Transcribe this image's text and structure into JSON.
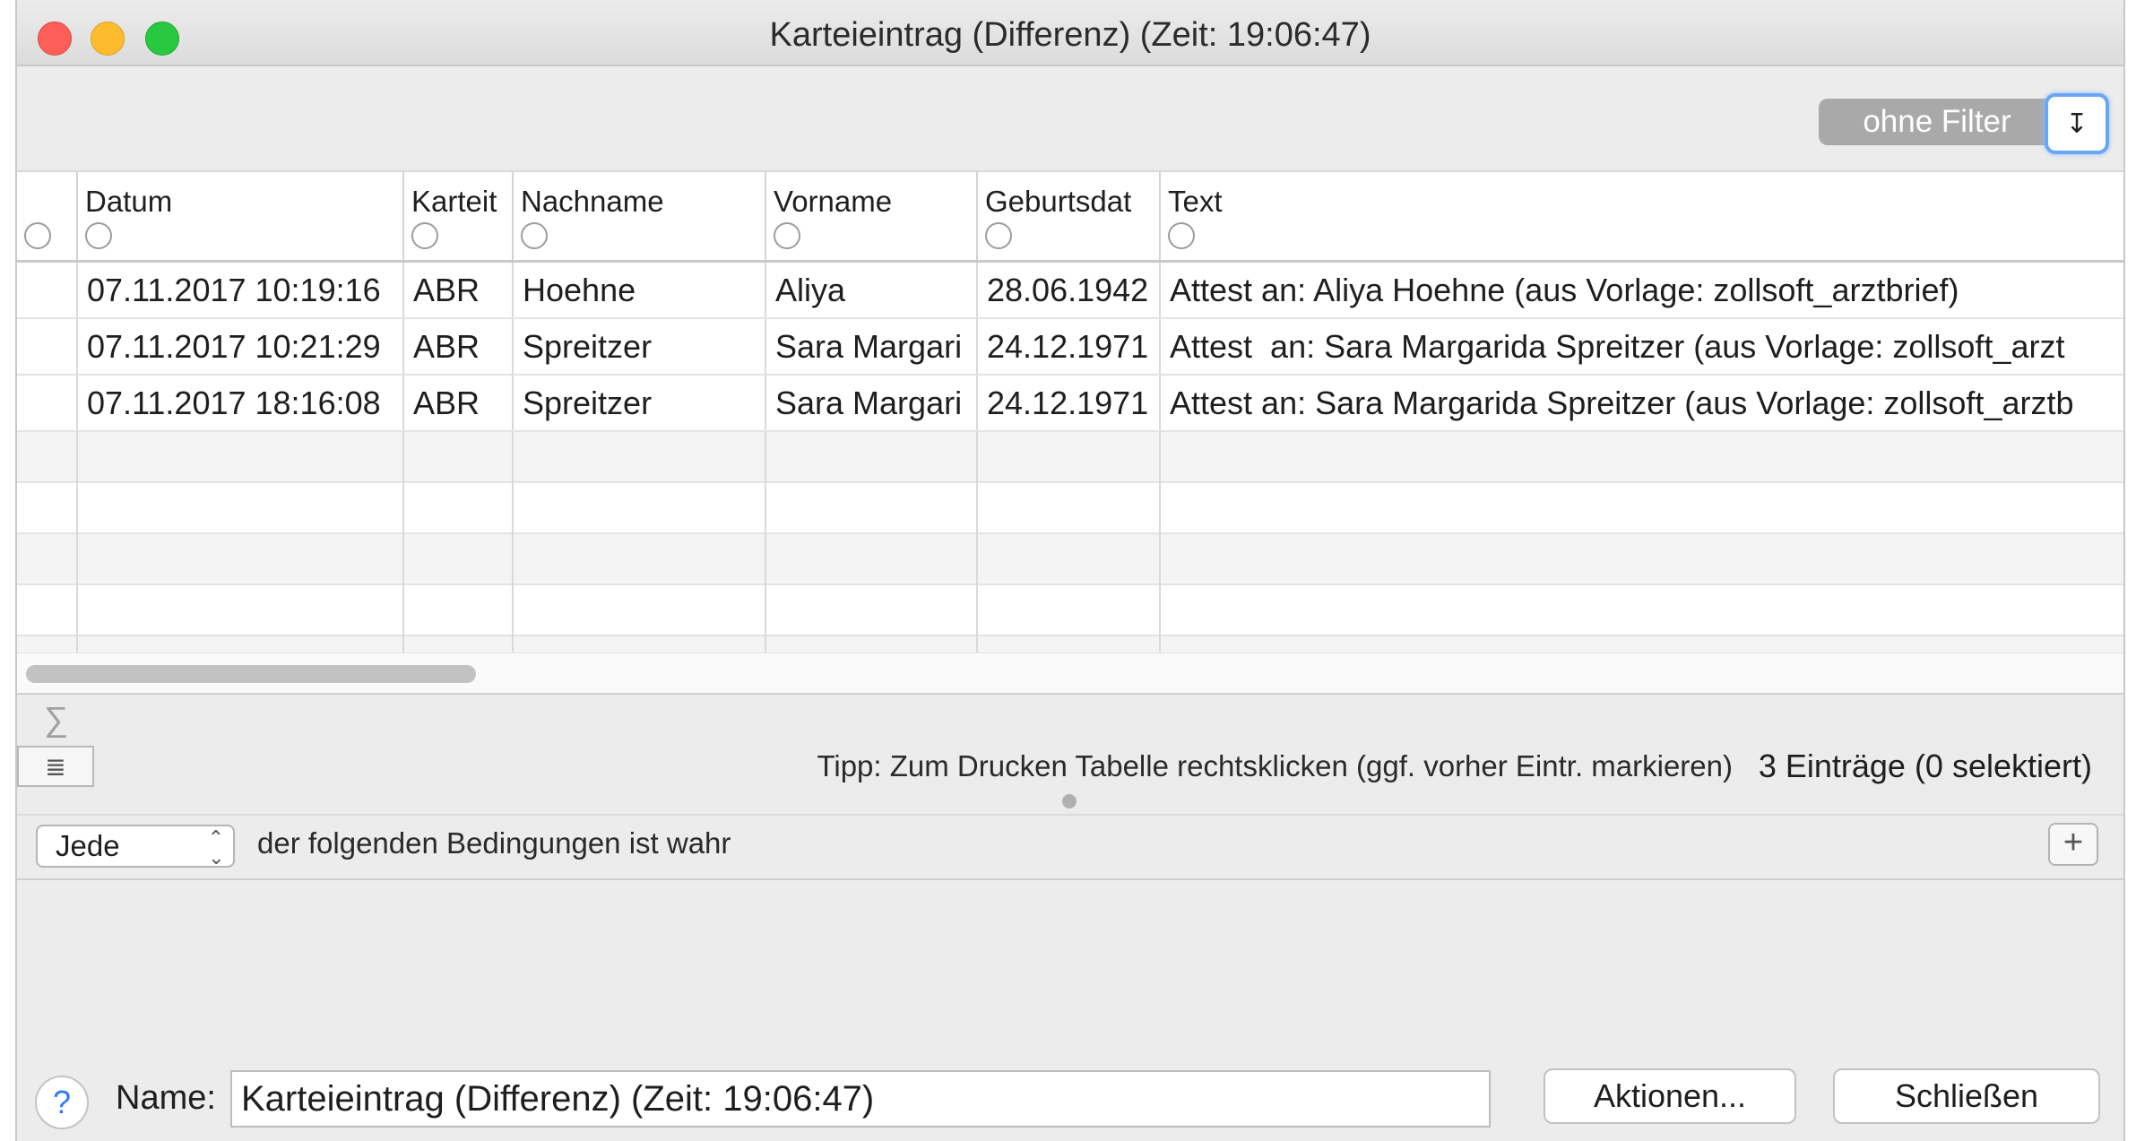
{
  "window": {
    "title": "Karteieintrag (Differenz) (Zeit: 19:06:47)"
  },
  "filter": {
    "label": "ohne Filter",
    "button_glyph": "↧"
  },
  "table": {
    "columns": [
      "Datum",
      "Karteit",
      "Nachname",
      "Vorname",
      "Geburtsdat",
      "Text"
    ],
    "rows": [
      [
        "07.11.2017 10:19:16",
        "ABR",
        "Hoehne",
        "Aliya",
        "28.06.1942",
        "Attest an: Aliya Hoehne (aus Vorlage: zollsoft_arztbrief)"
      ],
      [
        "07.11.2017 10:21:29",
        "ABR",
        "Spreitzer",
        "Sara Margari",
        "24.12.1971",
        "Attest  an: Sara Margarida Spreitzer (aus Vorlage: zollsoft_arzt"
      ],
      [
        "07.11.2017 18:16:08",
        "ABR",
        "Spreitzer",
        "Sara Margari",
        "24.12.1971",
        "Attest an: Sara Margarida Spreitzer (aus Vorlage: zollsoft_arztb"
      ]
    ]
  },
  "status": {
    "sigma": "∑",
    "tip": "Tipp: Zum Drucken Tabelle rechtsklicken (ggf. vorher Eintr. markieren)",
    "count": "3 Einträge (0 selektiert)"
  },
  "conditions": {
    "match_select": "Jede",
    "text": "der folgenden Bedingungen ist wahr",
    "add_glyph": "+"
  },
  "footer": {
    "help_glyph": "?",
    "name_label": "Name:",
    "name_value": "Karteieintrag (Differenz) (Zeit: 19:06:47)",
    "actions_label": "Aktionen...",
    "close_label": "Schließen"
  }
}
